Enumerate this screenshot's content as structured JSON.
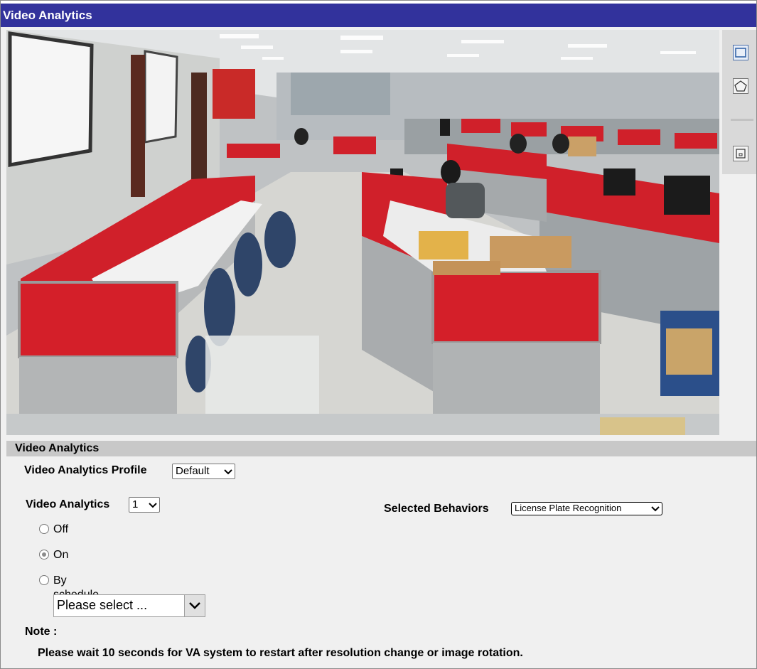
{
  "window": {
    "title": "Video Analytics"
  },
  "toolbar": {
    "tools": [
      {
        "icon": "rectangle-tool-icon",
        "active": true
      },
      {
        "icon": "polygon-tool-icon",
        "active": false
      },
      {
        "icon": "clear-region-icon",
        "active": false
      }
    ]
  },
  "settings": {
    "section_title": "Video Analytics",
    "profile_label": "Video Analytics Profile",
    "profile_value": "Default",
    "va_label": "Video Analytics",
    "va_value": "1",
    "behaviors_label": "Selected Behaviors",
    "behaviors_value": "License Plate Recognition",
    "mode_options": [
      {
        "label": "Off",
        "checked": false
      },
      {
        "label": "On",
        "checked": true
      },
      {
        "label": "By schedule",
        "checked": false
      }
    ],
    "schedule_placeholder": "Please select ...",
    "note_title": "Note :",
    "note_text": "Please wait 10 seconds for VA system to restart after resolution change or image rotation."
  },
  "colors": {
    "title_bar": "#32329c",
    "header_bar": "#c8c8c8",
    "cubicle_red": "#d0202a"
  }
}
